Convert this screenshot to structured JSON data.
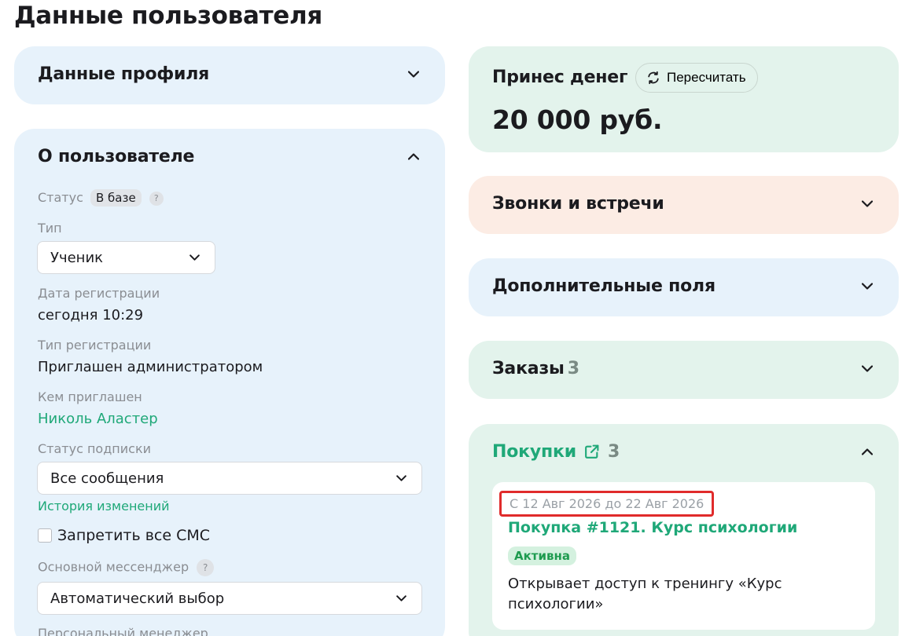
{
  "page": {
    "title": "Данные пользователя"
  },
  "profile_section": {
    "title": "Данные профиля"
  },
  "about": {
    "title": "О пользователе",
    "status_label": "Статус",
    "status_value": "В базе",
    "help_mark": "?",
    "type_label": "Тип",
    "type_value": "Ученик",
    "reg_date_label": "Дата регистрации",
    "reg_date_value": "сегодня 10:29",
    "reg_type_label": "Тип регистрации",
    "reg_type_value": "Приглашен администратором",
    "invited_by_label": "Кем приглашен",
    "invited_by_value": "Николь Аластер",
    "subscription_label": "Статус подписки",
    "subscription_value": "Все сообщения",
    "history_link": "История изменений",
    "block_sms_label": "Запретить все СМС",
    "messenger_label": "Основной мессенджер",
    "messenger_value": "Автоматический выбор",
    "manager_label": "Персональный менеджер"
  },
  "money": {
    "title": "Принес денег",
    "recalc_label": "Пересчитать",
    "amount": "20 000 руб."
  },
  "calls": {
    "title": "Звонки и встречи"
  },
  "extra_fields": {
    "title": "Дополнительные поля"
  },
  "orders": {
    "title": "Заказы",
    "count": "3"
  },
  "purchases": {
    "title": "Покупки",
    "count": "3",
    "items": [
      {
        "date_range": "С 12 Авг 2026 до 22 Авг 2026",
        "title": "Покупка #1121. Курс психологии",
        "status": "Активна",
        "description": "Открывает доступ к тренингу «Курс психологии»"
      }
    ]
  },
  "colors": {
    "accent_green": "#1fa878",
    "highlight_red": "#e02b2b",
    "card_blue": "#e7f2fb",
    "card_green": "#e3f3ec",
    "card_peach": "#fcece4"
  },
  "icons": [
    "chevron-down-icon",
    "chevron-up-icon",
    "refresh-icon",
    "external-link-icon",
    "help-icon"
  ]
}
